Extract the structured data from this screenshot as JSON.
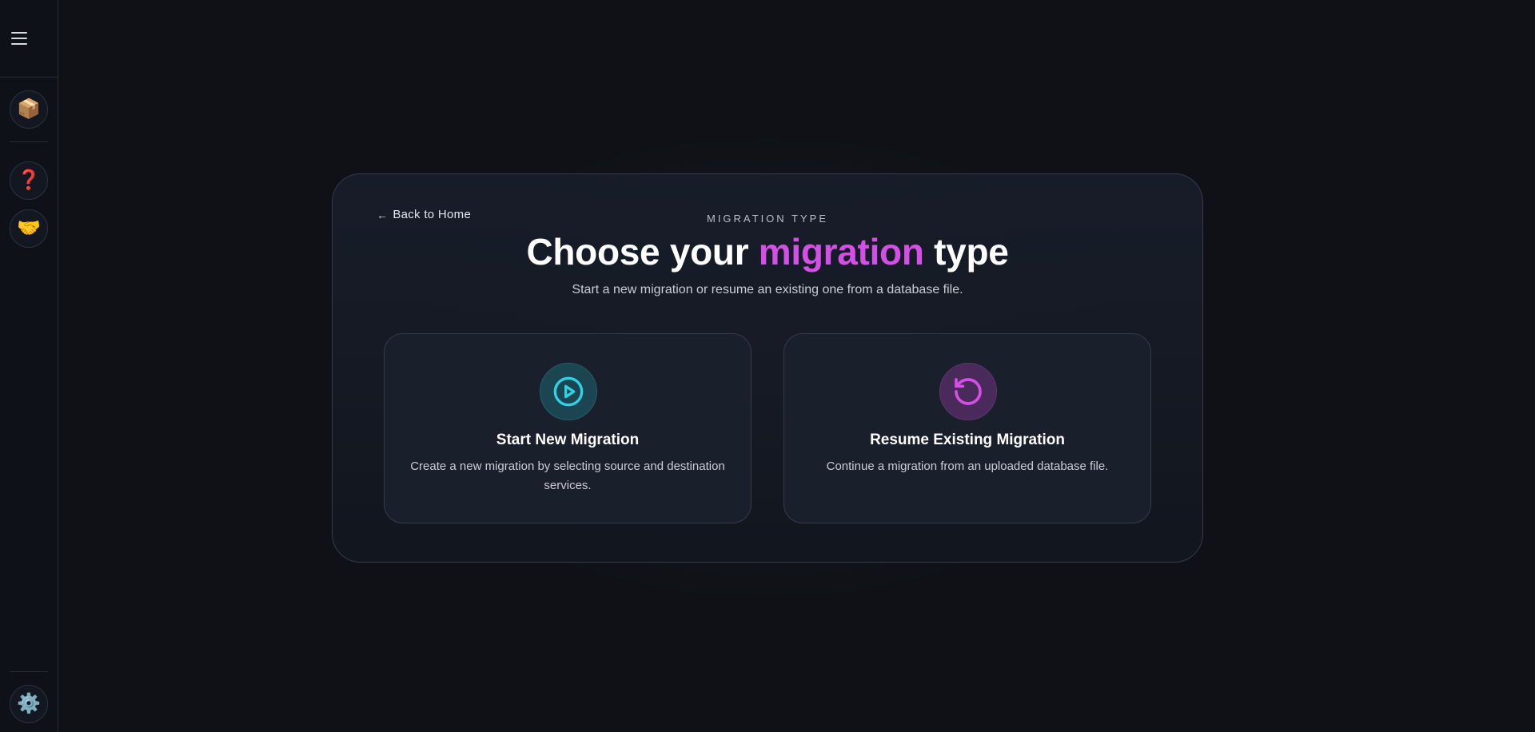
{
  "sidebar": {
    "menu_icon": "hamburger-icon",
    "items": [
      {
        "name": "package",
        "icon": "📦"
      },
      {
        "name": "help",
        "icon": "❓"
      },
      {
        "name": "handshake",
        "icon": "🤝"
      }
    ],
    "settings": {
      "name": "settings",
      "icon": "⚙️"
    }
  },
  "panel": {
    "back_label": "Back to Home",
    "back_arrow": "←",
    "eyebrow": "MIGRATION TYPE",
    "title_before": "Choose your ",
    "title_accent": "migration",
    "title_after": " type",
    "subtitle": "Start a new migration or resume an existing one from a database file."
  },
  "options": [
    {
      "title": "Start New Migration",
      "description": "Create a new migration by selecting source and destination services.",
      "icon": "play-circle-icon",
      "color": "#2fd3e6"
    },
    {
      "title": "Resume Existing Migration",
      "description": "Continue a migration from an uploaded database file.",
      "icon": "rotate-ccw-icon",
      "color": "#d34fe6"
    }
  ],
  "colors": {
    "accent": "#d34fe6",
    "teal": "#2fd3e6",
    "background": "#0f1116"
  }
}
